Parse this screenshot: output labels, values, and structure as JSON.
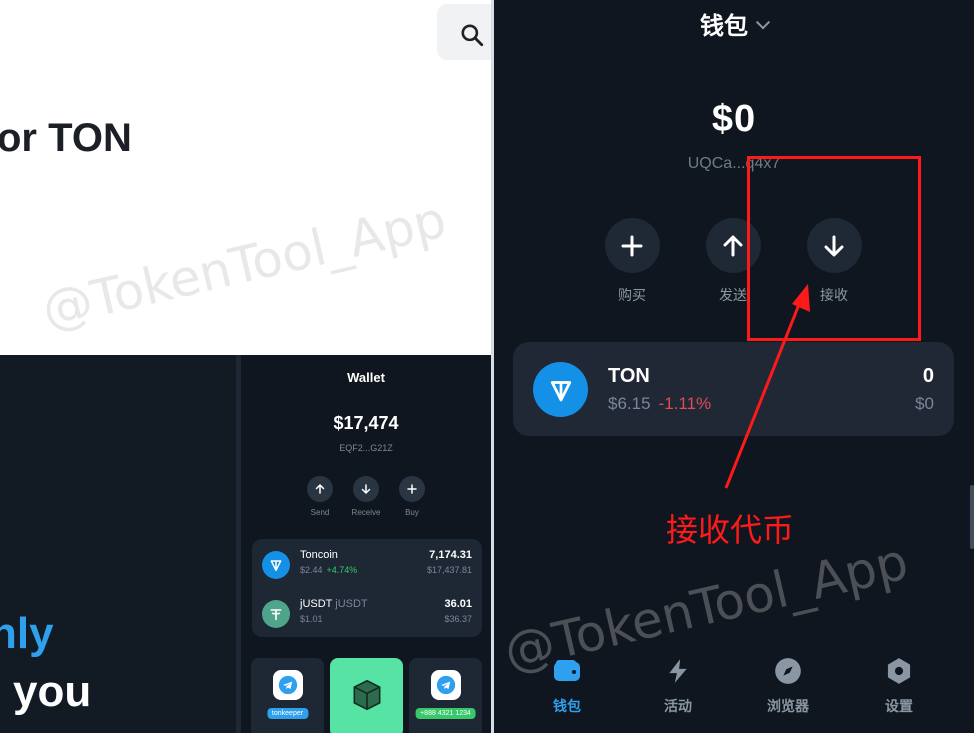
{
  "left_top": {
    "heading": "or TON"
  },
  "left_bottom": {
    "hero_line1": "nly",
    "hero_line2": "you"
  },
  "mock_wallet": {
    "title": "Wallet",
    "balance": "$17,474",
    "address": "EQF2...G21Z",
    "actions": [
      {
        "label": "Send",
        "icon": "arrow-up-icon"
      },
      {
        "label": "Receive",
        "icon": "arrow-down-icon"
      },
      {
        "label": "Buy",
        "icon": "plus-icon"
      }
    ],
    "assets": [
      {
        "name": "Toncoin",
        "price": "$2.44",
        "change": "+4.74%",
        "amount": "7,174.31",
        "fiat": "$17,437.81",
        "color": "#1490e6"
      },
      {
        "name": "jUSDT",
        "tag": "jUSDT",
        "price": "$1.01",
        "change": "",
        "amount": "36.01",
        "fiat": "$36.37",
        "color": "#4fa58b"
      }
    ],
    "tiles": [
      {
        "tag": "tonkeeper",
        "bg": "#1e2734",
        "tag_bg": "#2fa0ee"
      },
      {
        "tag": "",
        "bg": "#56e3a3",
        "tag_bg": ""
      },
      {
        "tag": "+888 4321 1234",
        "bg": "#1e2734",
        "tag_bg": "#37c86a"
      }
    ]
  },
  "wallet": {
    "title": "钱包",
    "balance": "$0",
    "address": "UQCa...q4x7",
    "actions": [
      {
        "label": "购买",
        "icon": "plus-icon"
      },
      {
        "label": "发送",
        "icon": "arrow-up-icon"
      },
      {
        "label": "接收",
        "icon": "arrow-down-icon"
      }
    ],
    "asset": {
      "name": "TON",
      "price": "$6.15",
      "change": "-1.11%",
      "amount": "0",
      "fiat": "$0"
    },
    "tabs": [
      {
        "label": "钱包",
        "icon": "wallet-icon",
        "active": true
      },
      {
        "label": "活动",
        "icon": "lightning-icon",
        "active": false
      },
      {
        "label": "浏览器",
        "icon": "compass-icon",
        "active": false
      },
      {
        "label": "设置",
        "icon": "gear-icon",
        "active": false
      }
    ]
  },
  "annotation": {
    "label": "接收代币",
    "color": "#ff1a1a"
  },
  "watermark": "@TokenTool_App",
  "colors": {
    "accent": "#2fa0ee",
    "ton_blue": "#1490e6",
    "negative": "#e04a57",
    "positive": "#37c86a",
    "background": "#10161f"
  }
}
